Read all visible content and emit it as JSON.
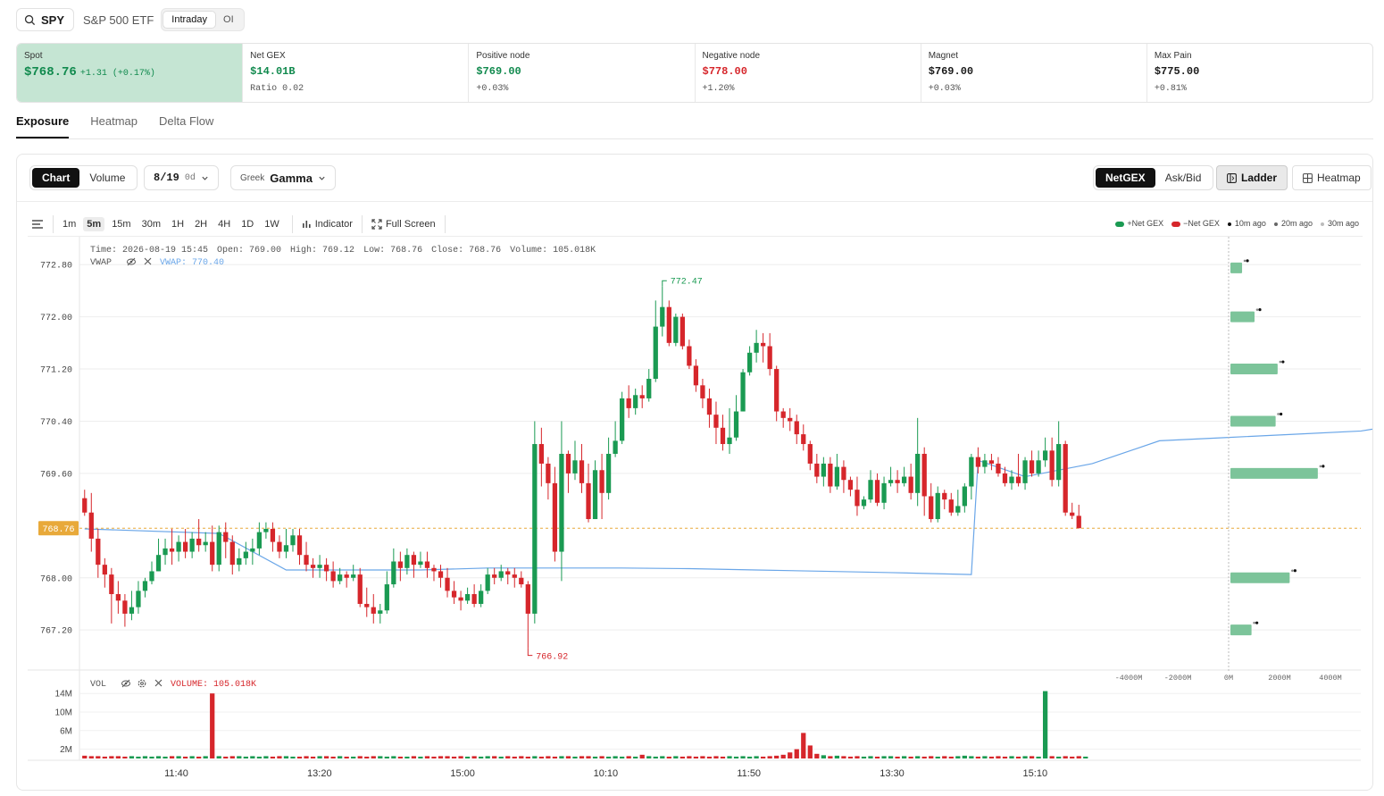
{
  "header": {
    "symbol": "SPY",
    "name": "S&P 500 ETF",
    "modes": [
      "Intraday",
      "OI"
    ],
    "active_mode": "Intraday"
  },
  "stats": [
    {
      "label": "Spot",
      "value": "$768.76",
      "change": "+1.31 (+0.17%)",
      "sub": ""
    },
    {
      "label": "Net GEX",
      "value": "$14.01B",
      "change": "",
      "sub": "Ratio 0.02"
    },
    {
      "label": "Positive node",
      "value": "$769.00",
      "change": "",
      "sub": "+0.03%"
    },
    {
      "label": "Negative node",
      "value": "$778.00",
      "change": "",
      "sub": "+1.20%"
    },
    {
      "label": "Magnet",
      "value": "$769.00",
      "change": "",
      "sub": "+0.03%"
    },
    {
      "label": "Max Pain",
      "value": "$775.00",
      "change": "",
      "sub": "+0.81%"
    }
  ],
  "tabs": [
    "Exposure",
    "Heatmap",
    "Delta Flow"
  ],
  "active_tab": "Exposure",
  "controls": {
    "view": [
      "Chart",
      "Volume"
    ],
    "active_view": "Chart",
    "expiry": "8/19",
    "dte": "0d",
    "greek_label": "Greek",
    "greek": "Gamma",
    "mode": [
      "NetGEX",
      "Ask/Bid"
    ],
    "active_mode": "NetGEX",
    "layout": [
      "Ladder",
      "Heatmap"
    ],
    "active_layout": "Ladder"
  },
  "toolbar": {
    "timeframes": [
      "1m",
      "5m",
      "15m",
      "30m",
      "1H",
      "2H",
      "4H",
      "1D",
      "1W"
    ],
    "active_timeframe": "5m",
    "indicator": "Indicator",
    "fullscreen": "Full Screen"
  },
  "legend": {
    "pos": "+Net GEX",
    "neg": "−Net GEX",
    "t10": "10m ago",
    "t20": "20m ago",
    "t30": "30m ago"
  },
  "colors": {
    "up": "#1a9a52",
    "down": "#d6262b",
    "vwap": "#6aa6e8",
    "gex_pos": "#7cc49a",
    "last_price": "#e8a93a"
  },
  "ohlc_info": {
    "time": "Time: 2026-08-19 15:45",
    "open": "Open: 769.00",
    "high": "High: 769.12",
    "low": "Low: 768.76",
    "close": "Close: 768.76",
    "volume": "Volume: 105.018K",
    "vwap_label": "VWAP",
    "vwap_value": "VWAP: 770.40"
  },
  "vol_info": {
    "label": "VOL",
    "value": "VOLUME: 105.018K"
  },
  "chart_data": {
    "type": "candlestick",
    "y_ticks": [
      "772.80",
      "772.00",
      "771.20",
      "770.40",
      "769.60",
      "768.00",
      "767.20"
    ],
    "ylim": [
      766.6,
      773.2
    ],
    "last_price": 768.76,
    "last_price_label": "768.76",
    "high_marker": {
      "value": 772.47,
      "label": "772.47"
    },
    "low_marker": {
      "value": 766.92,
      "label": "766.92"
    },
    "x_ticks": [
      "11:40",
      "13:20",
      "15:00",
      "10:10",
      "11:50",
      "13:30",
      "15:10"
    ],
    "candles": [
      [
        769.22,
        769.0,
        769.35,
        768.95
      ],
      [
        769.0,
        768.6,
        769.3,
        768.4
      ],
      [
        768.6,
        768.2,
        768.75,
        768.0
      ],
      [
        768.2,
        768.05,
        768.3,
        767.85
      ],
      [
        768.05,
        767.75,
        768.15,
        767.3
      ],
      [
        767.75,
        767.65,
        767.95,
        767.45
      ],
      [
        767.65,
        767.45,
        767.75,
        767.25
      ],
      [
        767.45,
        767.55,
        767.8,
        767.35
      ],
      [
        767.55,
        767.8,
        767.95,
        767.45
      ],
      [
        767.8,
        767.95,
        768.0,
        767.7
      ],
      [
        767.95,
        768.1,
        768.25,
        767.9
      ],
      [
        768.1,
        768.35,
        768.6,
        768.1
      ],
      [
        768.35,
        768.45,
        768.6,
        768.2
      ],
      [
        768.45,
        768.4,
        768.75,
        768.2
      ],
      [
        768.4,
        768.55,
        768.65,
        768.25
      ],
      [
        768.55,
        768.4,
        768.75,
        768.3
      ],
      [
        768.4,
        768.6,
        768.7,
        768.3
      ],
      [
        768.6,
        768.5,
        768.9,
        768.4
      ],
      [
        768.5,
        768.55,
        768.7,
        768.4
      ],
      [
        768.55,
        768.2,
        768.8,
        768.1
      ],
      [
        768.2,
        768.7,
        768.8,
        768.1
      ],
      [
        768.7,
        768.55,
        768.85,
        768.3
      ],
      [
        768.55,
        768.2,
        768.65,
        768.05
      ],
      [
        768.2,
        768.3,
        768.45,
        768.1
      ],
      [
        768.3,
        768.4,
        768.55,
        768.2
      ],
      [
        768.4,
        768.45,
        768.6,
        768.2
      ],
      [
        768.45,
        768.7,
        768.85,
        768.35
      ],
      [
        768.7,
        768.75,
        768.85,
        768.6
      ],
      [
        768.75,
        768.55,
        768.85,
        768.4
      ],
      [
        768.55,
        768.4,
        768.65,
        768.3
      ],
      [
        768.4,
        768.5,
        768.75,
        768.3
      ],
      [
        768.5,
        768.65,
        768.75,
        768.4
      ],
      [
        768.65,
        768.35,
        768.75,
        768.2
      ],
      [
        768.35,
        768.2,
        768.55,
        768.1
      ],
      [
        768.2,
        768.15,
        768.3,
        768.0
      ],
      [
        768.15,
        768.2,
        768.35,
        768.0
      ],
      [
        768.2,
        768.1,
        768.3,
        767.95
      ],
      [
        768.1,
        767.95,
        768.25,
        767.85
      ],
      [
        767.95,
        768.05,
        768.15,
        767.9
      ],
      [
        768.05,
        768.0,
        768.1,
        767.85
      ],
      [
        768.0,
        768.05,
        768.2,
        767.95
      ],
      [
        768.05,
        767.6,
        768.15,
        767.55
      ],
      [
        767.6,
        767.55,
        767.85,
        767.4
      ],
      [
        767.55,
        767.45,
        767.75,
        767.3
      ],
      [
        767.45,
        767.5,
        767.6,
        767.3
      ],
      [
        767.5,
        767.9,
        768.1,
        767.45
      ],
      [
        767.9,
        768.25,
        768.45,
        767.85
      ],
      [
        768.25,
        768.15,
        768.4,
        767.95
      ],
      [
        768.15,
        768.35,
        768.45,
        768.05
      ],
      [
        768.35,
        768.2,
        768.4,
        768.0
      ],
      [
        768.2,
        768.25,
        768.4,
        768.15
      ],
      [
        768.25,
        768.15,
        768.4,
        768.0
      ],
      [
        768.15,
        768.1,
        768.2,
        767.95
      ],
      [
        768.1,
        768.0,
        768.2,
        767.85
      ],
      [
        768.0,
        767.8,
        768.15,
        767.7
      ],
      [
        767.8,
        767.7,
        767.95,
        767.6
      ],
      [
        767.7,
        767.65,
        767.8,
        767.5
      ],
      [
        767.65,
        767.75,
        767.85,
        767.6
      ],
      [
        767.75,
        767.6,
        767.9,
        767.55
      ],
      [
        767.6,
        767.8,
        767.9,
        767.55
      ],
      [
        767.8,
        768.05,
        768.15,
        767.75
      ],
      [
        768.05,
        768.0,
        768.15,
        767.9
      ],
      [
        768.0,
        768.1,
        768.2,
        767.95
      ],
      [
        768.1,
        768.05,
        768.15,
        767.9
      ],
      [
        768.05,
        768.0,
        768.15,
        767.85
      ],
      [
        768.0,
        767.9,
        768.1,
        767.85
      ],
      [
        767.9,
        767.45,
        767.95,
        766.92
      ],
      [
        767.45,
        770.05,
        770.4,
        767.3
      ],
      [
        770.05,
        769.75,
        770.3,
        769.4
      ],
      [
        769.75,
        769.45,
        769.85,
        769.2
      ],
      [
        769.45,
        768.4,
        769.7,
        768.25
      ],
      [
        768.4,
        769.9,
        770.4,
        767.95
      ],
      [
        769.9,
        769.6,
        769.95,
        769.3
      ],
      [
        769.6,
        769.8,
        770.1,
        769.5
      ],
      [
        769.8,
        769.45,
        770.05,
        769.3
      ],
      [
        769.45,
        768.9,
        769.75,
        768.85
      ],
      [
        768.9,
        769.65,
        769.8,
        768.9
      ],
      [
        769.65,
        769.3,
        769.9,
        768.9
      ],
      [
        769.3,
        769.9,
        770.15,
        769.2
      ],
      [
        769.9,
        770.1,
        770.4,
        769.85
      ],
      [
        770.1,
        770.75,
        770.85,
        770.05
      ],
      [
        770.75,
        770.6,
        770.95,
        770.45
      ],
      [
        770.6,
        770.8,
        770.9,
        770.5
      ],
      [
        770.8,
        770.75,
        770.95,
        770.6
      ],
      [
        770.75,
        771.05,
        771.2,
        770.7
      ],
      [
        771.05,
        771.85,
        772.25,
        771.0
      ],
      [
        771.85,
        772.15,
        772.47,
        771.7
      ],
      [
        772.15,
        771.6,
        772.25,
        771.55
      ],
      [
        771.6,
        772.0,
        772.05,
        771.55
      ],
      [
        772.0,
        771.55,
        772.05,
        771.5
      ],
      [
        771.55,
        771.25,
        771.65,
        771.2
      ],
      [
        771.25,
        770.95,
        771.35,
        770.85
      ],
      [
        770.95,
        770.75,
        771.05,
        770.6
      ],
      [
        770.75,
        770.5,
        770.9,
        770.3
      ],
      [
        770.5,
        770.3,
        770.7,
        770.05
      ],
      [
        770.3,
        770.05,
        770.5,
        769.95
      ],
      [
        770.05,
        770.15,
        770.6,
        769.9
      ],
      [
        770.15,
        770.55,
        770.8,
        770.1
      ],
      [
        770.55,
        771.15,
        771.2,
        770.55
      ],
      [
        771.15,
        771.45,
        771.55,
        771.1
      ],
      [
        771.45,
        771.6,
        771.8,
        771.3
      ],
      [
        771.6,
        771.55,
        771.75,
        771.3
      ],
      [
        771.55,
        771.2,
        771.75,
        771.1
      ],
      [
        771.2,
        770.55,
        771.25,
        770.4
      ],
      [
        770.55,
        770.45,
        770.6,
        770.3
      ],
      [
        770.45,
        770.4,
        770.6,
        770.25
      ],
      [
        770.4,
        770.2,
        770.5,
        770.05
      ],
      [
        770.2,
        770.05,
        770.35,
        769.95
      ],
      [
        770.05,
        769.75,
        770.1,
        769.65
      ],
      [
        769.75,
        769.55,
        769.9,
        769.45
      ],
      [
        769.55,
        769.75,
        769.85,
        769.4
      ],
      [
        769.75,
        769.4,
        769.85,
        769.3
      ],
      [
        769.4,
        769.7,
        769.9,
        769.35
      ],
      [
        769.7,
        769.5,
        769.8,
        769.3
      ],
      [
        769.5,
        769.35,
        769.55,
        769.25
      ],
      [
        769.35,
        769.1,
        769.55,
        768.95
      ],
      [
        769.1,
        769.2,
        769.25,
        769.05
      ],
      [
        769.2,
        769.5,
        769.65,
        769.15
      ],
      [
        769.5,
        769.15,
        769.6,
        769.1
      ],
      [
        769.15,
        769.45,
        769.55,
        769.05
      ],
      [
        769.45,
        769.5,
        769.7,
        769.4
      ],
      [
        769.5,
        769.45,
        769.65,
        769.3
      ],
      [
        769.45,
        769.55,
        769.7,
        769.4
      ],
      [
        769.55,
        769.3,
        769.75,
        769.2
      ],
      [
        769.3,
        769.9,
        770.45,
        769.1
      ],
      [
        769.9,
        769.25,
        770.0,
        768.95
      ],
      [
        769.25,
        768.9,
        769.45,
        768.85
      ],
      [
        768.9,
        769.3,
        769.4,
        768.85
      ],
      [
        769.3,
        769.2,
        769.35,
        769.05
      ],
      [
        769.2,
        769.0,
        769.3,
        768.95
      ],
      [
        769.0,
        769.1,
        769.35,
        768.95
      ],
      [
        769.1,
        769.4,
        769.45,
        769.0
      ],
      [
        769.4,
        769.85,
        769.9,
        769.2
      ],
      [
        769.85,
        769.7,
        770.0,
        769.6
      ],
      [
        769.7,
        769.8,
        769.9,
        769.6
      ],
      [
        769.8,
        769.75,
        769.9,
        769.65
      ],
      [
        769.75,
        769.6,
        769.85,
        769.55
      ],
      [
        769.6,
        769.45,
        769.7,
        769.4
      ],
      [
        769.45,
        769.55,
        769.65,
        769.35
      ],
      [
        769.55,
        769.45,
        769.9,
        769.4
      ],
      [
        769.45,
        769.8,
        769.85,
        769.35
      ],
      [
        769.8,
        769.6,
        769.95,
        769.55
      ],
      [
        769.6,
        769.8,
        769.95,
        769.55
      ],
      [
        769.8,
        769.95,
        770.15,
        769.7
      ],
      [
        769.95,
        769.5,
        770.15,
        769.4
      ],
      [
        769.5,
        770.05,
        770.4,
        769.4
      ],
      [
        770.05,
        769.0,
        770.1,
        768.95
      ],
      [
        769.0,
        768.95,
        769.15,
        768.9
      ],
      [
        768.95,
        768.76,
        769.12,
        768.76
      ]
    ],
    "volumes": [
      0.6,
      0.5,
      0.5,
      0.4,
      0.5,
      0.5,
      0.4,
      0.5,
      0.4,
      0.5,
      0.4,
      0.5,
      0.4,
      0.5,
      0.5,
      0.4,
      0.5,
      0.4,
      0.5,
      14.0,
      0.5,
      0.4,
      0.5,
      0.5,
      0.4,
      0.5,
      0.4,
      0.5,
      0.4,
      0.5,
      0.5,
      0.4,
      0.4,
      0.5,
      0.4,
      0.5,
      0.5,
      0.4,
      0.5,
      0.4,
      0.4,
      0.5,
      0.4,
      0.5,
      0.5,
      0.4,
      0.5,
      0.4,
      0.4,
      0.5,
      0.4,
      0.5,
      0.4,
      0.5,
      0.5,
      0.4,
      0.5,
      0.4,
      0.5,
      0.4,
      0.5,
      0.5,
      0.4,
      0.5,
      0.4,
      0.5,
      0.4,
      0.5,
      0.4,
      0.5,
      0.4,
      0.5,
      0.5,
      0.4,
      0.5,
      0.5,
      0.4,
      0.5,
      0.4,
      0.5,
      0.4,
      0.5,
      0.4,
      0.8,
      0.5,
      0.4,
      0.5,
      0.4,
      0.5,
      0.4,
      0.5,
      0.4,
      0.5,
      0.4,
      0.5,
      0.4,
      0.5,
      0.4,
      0.5,
      0.4,
      0.5,
      0.4,
      0.5,
      0.6,
      0.8,
      1.3,
      2.0,
      5.5,
      2.8,
      1.0,
      0.7,
      0.5,
      0.6,
      0.5,
      0.4,
      0.5,
      0.4,
      0.5,
      0.4,
      0.5,
      0.5,
      0.4,
      0.5,
      0.4,
      0.5,
      0.4,
      0.5,
      0.4,
      0.5,
      0.4,
      0.5,
      0.6,
      0.5,
      0.4,
      0.5,
      0.4,
      0.5,
      0.4,
      0.5,
      0.4,
      0.5,
      0.5,
      0.4,
      14.5,
      0.5,
      0.4,
      0.5,
      0.4,
      0.5,
      0.4
    ],
    "vwap_points": [
      [
        0,
        768.75
      ],
      [
        20,
        768.68
      ],
      [
        30,
        768.12
      ],
      [
        50,
        768.12
      ],
      [
        60,
        768.15
      ],
      [
        80,
        768.15
      ],
      [
        90,
        768.14
      ],
      [
        100,
        768.12
      ],
      [
        110,
        768.1
      ],
      [
        120,
        768.08
      ],
      [
        132,
        768.05
      ],
      [
        133,
        769.8
      ],
      [
        140,
        769.55
      ],
      [
        150,
        769.75
      ],
      [
        160,
        770.1
      ],
      [
        170,
        770.15
      ],
      [
        180,
        770.2
      ],
      [
        190,
        770.25
      ],
      [
        200,
        770.42
      ],
      [
        210,
        770.4
      ],
      [
        230,
        770.38
      ],
      [
        250,
        770.3
      ],
      [
        265,
        770.28
      ],
      [
        280,
        770.27
      ],
      [
        300,
        770.25
      ],
      [
        325,
        770.2
      ],
      [
        345,
        770.18
      ],
      [
        365,
        770.12
      ],
      [
        380,
        770.1
      ],
      [
        400,
        770.05
      ],
      [
        410,
        770.0
      ],
      [
        420,
        769.95
      ],
      [
        435,
        769.92
      ],
      [
        450,
        769.9
      ],
      [
        470,
        769.88
      ],
      [
        490,
        769.86
      ],
      [
        510,
        769.85
      ],
      [
        530,
        769.82
      ]
    ],
    "vol_ticks": [
      "14M",
      "10M",
      "6M",
      "2M"
    ],
    "vol_ylim": [
      0,
      15
    ],
    "gex_ladder": [
      {
        "price": 772.75,
        "value": 580
      },
      {
        "price": 772.0,
        "value": 1200
      },
      {
        "price": 771.2,
        "value": 2350
      },
      {
        "price": 770.4,
        "value": 2250
      },
      {
        "price": 769.6,
        "value": 4350
      },
      {
        "price": 768.0,
        "value": 2950
      },
      {
        "price": 767.2,
        "value": 1050
      }
    ],
    "gex_xticks": [
      "-4000M",
      "-2000M",
      "0M",
      "2000M",
      "4000M"
    ],
    "gex_xlim": [
      -5000,
      5000
    ]
  }
}
